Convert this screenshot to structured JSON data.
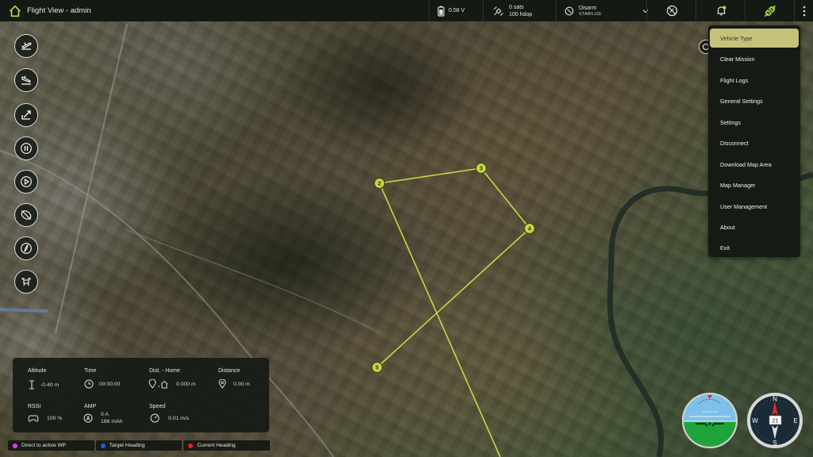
{
  "header": {
    "title": "Flight View - admin",
    "battery": "0.58 V",
    "gps_sats": "0 sats",
    "gps_hdop": "100 hdop",
    "arm_state": "Disarm",
    "flight_mode": "STABILIZE"
  },
  "menu": {
    "items": [
      {
        "label": "Vehicle Type"
      },
      {
        "label": "Clear Mission"
      },
      {
        "label": "Flight Logs"
      },
      {
        "label": "General Settings"
      },
      {
        "label": "Settings"
      },
      {
        "label": "Disconnect"
      },
      {
        "label": "Download Map Area"
      },
      {
        "label": "Map Manager"
      },
      {
        "label": "User Management"
      },
      {
        "label": "About"
      },
      {
        "label": "Exit"
      }
    ],
    "active_index": 0
  },
  "mission": {
    "waypoints": [
      {
        "label": "2"
      },
      {
        "label": "3"
      },
      {
        "label": "4"
      },
      {
        "label": "5"
      }
    ],
    "route_color": "#c9d645"
  },
  "telemetry": {
    "altitude_label": "Altitude",
    "altitude_value": "-0.40 m",
    "time_label": "Time",
    "time_value": "00:00:00",
    "dist_home_label": "Dist. - Home",
    "dist_home_value": "0.000 m",
    "distance_label": "Distance",
    "distance_value": "0.00 m",
    "rssi_label": "RSSI",
    "rssi_value": "100 %",
    "amp_label": "AMP",
    "amp_current": "0 A",
    "amp_capacity": "186 mAh",
    "speed_label": "Speed",
    "speed_value": "0.01 m/s"
  },
  "legend": [
    {
      "label": "Direct to active WP",
      "color": "#e040e0"
    },
    {
      "label": "Target Heading",
      "color": "#2a5bd7"
    },
    {
      "label": "Current Heading",
      "color": "#e02020"
    }
  ],
  "compass": {
    "heading": "21",
    "n": "N",
    "e": "E",
    "s": "S",
    "w": "W"
  }
}
